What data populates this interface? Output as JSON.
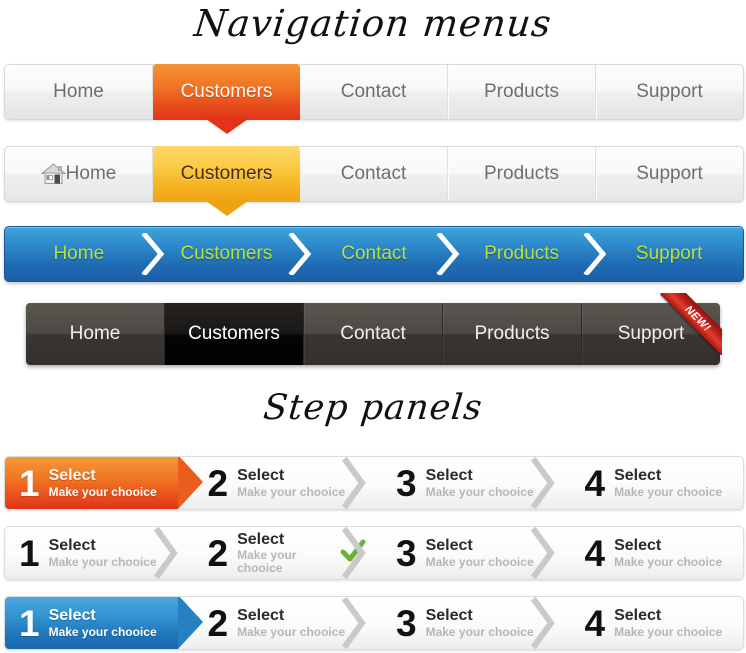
{
  "headings": {
    "navigation": "Navigation menus",
    "steps": "Step panels"
  },
  "colors": {
    "orange_top": "#f49434",
    "orange_bottom": "#e2341a",
    "yellow_top": "#fdd968",
    "yellow_bottom": "#eea313",
    "blue_top": "#3fa4dd",
    "blue_bottom": "#1b5ea6",
    "breadcrumb_text": "#b9e23f",
    "dark_bar": "#4e4944",
    "dark_active": "#000000",
    "ribbon_red": "#c0201a",
    "check_green": "#6ab23c",
    "step_subtitle_gray": "#b6b6b6"
  },
  "navbars": [
    {
      "id": "nav-light-orange",
      "style": "light-orange",
      "items": [
        {
          "label": "Home",
          "active": false
        },
        {
          "label": "Customers",
          "active": true
        },
        {
          "label": "Contact",
          "active": false
        },
        {
          "label": "Products",
          "active": false
        },
        {
          "label": "Support",
          "active": false
        }
      ]
    },
    {
      "id": "nav-light-yellow",
      "style": "light-yellow",
      "icon": "house-icon",
      "items": [
        {
          "label": "Home",
          "active": false
        },
        {
          "label": "Customers",
          "active": true
        },
        {
          "label": "Contact",
          "active": false
        },
        {
          "label": "Products",
          "active": false
        },
        {
          "label": "Support",
          "active": false
        }
      ]
    },
    {
      "id": "nav-blue-breadcrumb",
      "style": "blue-breadcrumb",
      "separator_icon": "chevron-right-icon",
      "items": [
        {
          "label": "Home",
          "active": false
        },
        {
          "label": "Customers",
          "active": false
        },
        {
          "label": "Contact",
          "active": false
        },
        {
          "label": "Products",
          "active": false
        },
        {
          "label": "Support",
          "active": false
        }
      ]
    },
    {
      "id": "nav-dark",
      "style": "dark",
      "badge": "NEW!",
      "items": [
        {
          "label": "Home",
          "active": false
        },
        {
          "label": "Customers",
          "active": true
        },
        {
          "label": "Contact",
          "active": false
        },
        {
          "label": "Products",
          "active": false
        },
        {
          "label": "Support",
          "active": false
        }
      ]
    }
  ],
  "step_rows": [
    {
      "id": "steps-row-1",
      "highlight": "orange",
      "steps": [
        {
          "number": "1",
          "title": "Select",
          "subtitle": "Make your chooice",
          "active": true,
          "check": false
        },
        {
          "number": "2",
          "title": "Select",
          "subtitle": "Make your chooice",
          "active": false,
          "check": false
        },
        {
          "number": "3",
          "title": "Select",
          "subtitle": "Make your chooice",
          "active": false,
          "check": false
        },
        {
          "number": "4",
          "title": "Select",
          "subtitle": "Make your chooice",
          "active": false,
          "check": false
        }
      ]
    },
    {
      "id": "steps-row-2",
      "highlight": "none",
      "steps": [
        {
          "number": "1",
          "title": "Select",
          "subtitle": "Make your chooice",
          "active": false,
          "check": false
        },
        {
          "number": "2",
          "title": "Select",
          "subtitle": "Make your chooice",
          "active": false,
          "check": true
        },
        {
          "number": "3",
          "title": "Select",
          "subtitle": "Make your chooice",
          "active": false,
          "check": false
        },
        {
          "number": "4",
          "title": "Select",
          "subtitle": "Make your chooice",
          "active": false,
          "check": false
        }
      ]
    },
    {
      "id": "steps-row-3",
      "highlight": "blue",
      "steps": [
        {
          "number": "1",
          "title": "Select",
          "subtitle": "Make your chooice",
          "active": true,
          "check": false
        },
        {
          "number": "2",
          "title": "Select",
          "subtitle": "Make your chooice",
          "active": false,
          "check": false
        },
        {
          "number": "3",
          "title": "Select",
          "subtitle": "Make your chooice",
          "active": false,
          "check": false
        },
        {
          "number": "4",
          "title": "Select",
          "subtitle": "Make your chooice",
          "active": false,
          "check": false
        }
      ]
    }
  ]
}
